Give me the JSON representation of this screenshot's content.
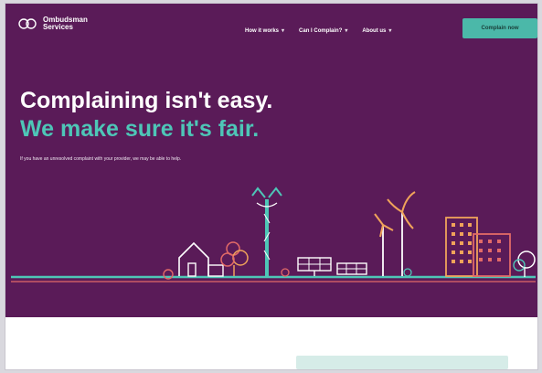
{
  "header": {
    "logo_line1": "Ombudsman",
    "logo_line2": "Services",
    "nav": [
      {
        "label": "How it works"
      },
      {
        "label": "Can I Complain?"
      },
      {
        "label": "About us"
      }
    ],
    "cta_label": "Complain now"
  },
  "hero": {
    "title_line1": "Complaining isn't easy.",
    "title_line2": "We make sure it's fair.",
    "subtitle": "If you have an unresolved complaint with your provider, we may be able to help."
  },
  "colors": {
    "hero_bg": "#5a1b58",
    "accent_teal": "#4ec6b7",
    "cta_bg": "#4bb8a9"
  },
  "icons": {
    "logo": "ombudsman-logo-mark",
    "dropdown": "chevron-down-icon"
  }
}
